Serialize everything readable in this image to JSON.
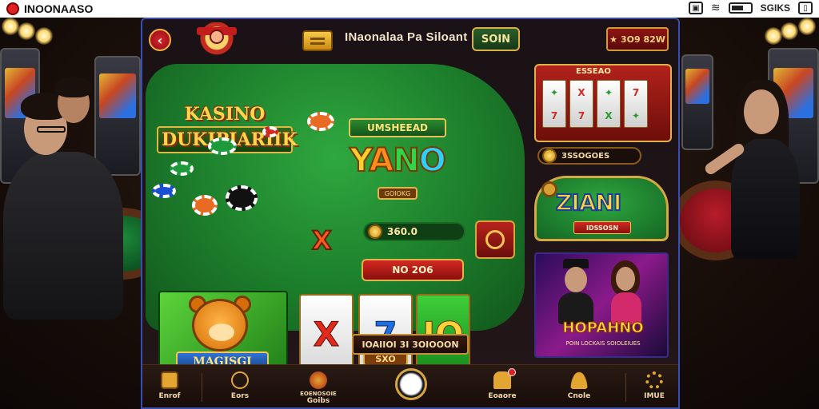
{
  "status_bar": {
    "app_name": "INOONAASO",
    "time_text": "SGIKS"
  },
  "header": {
    "title": "INaonalaa Pa Siloant",
    "signin_label": "SOIN",
    "bonus_label": "3O9 82W"
  },
  "table": {
    "logo_line1": "KASINO",
    "logo_line2": "DUKIPIARIIK",
    "yano_banner": "UMSHEEAD",
    "yano_title_y": "Y",
    "yano_title_a": "A",
    "yano_title_n": "N",
    "yano_title_o": "O",
    "yano_sub": "GOIOKG",
    "x_symbol": "X",
    "balance": "360.0",
    "play_label": "NO 2O6"
  },
  "tiles": {
    "magic_label": "MAGISGI",
    "reel1": "X",
    "reel2": "7",
    "reel3": "IO",
    "reel_sub": "SXO",
    "bet_label": "IOAIIOI 3I 3OIOOON"
  },
  "right": {
    "slots_title": "ESSEAO",
    "slots_coins": "3SSOGOES",
    "ziani_title": "ZIANI",
    "ziani_btn": "IDSSOSN",
    "hopano_title": "HOPAHNO",
    "hopano_sub": "POIN LOCKAIS SOIOLEIUES"
  },
  "nav": {
    "items": [
      {
        "label": "Enrof",
        "icon": "wallet-icon"
      },
      {
        "label": "Eors",
        "icon": "search-icon"
      },
      {
        "label": "Goibs",
        "icon": "chip-icon"
      },
      {
        "label": "Eoaore",
        "icon": "games-icon"
      },
      {
        "label": "Cnole",
        "icon": "user-icon"
      },
      {
        "label": "IMUE",
        "icon": "settings-icon"
      }
    ],
    "top_label": "EOENOSOIE"
  },
  "colors": {
    "accent_gold": "#e1b24a",
    "table_green": "#1c7d2b",
    "button_red": "#d22a22",
    "window_border": "#3b4fa8"
  }
}
